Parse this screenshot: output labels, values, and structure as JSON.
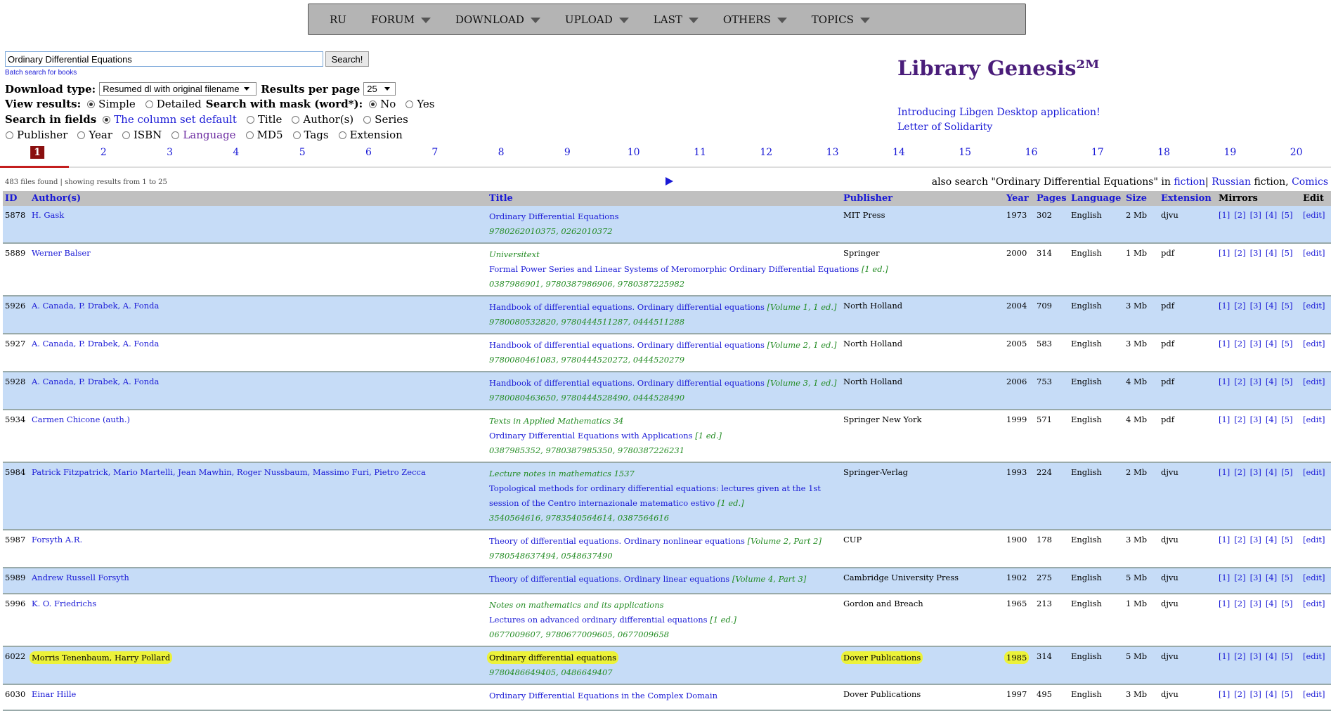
{
  "menu": [
    {
      "label": "RU",
      "caret": false
    },
    {
      "label": "FORUM",
      "caret": true
    },
    {
      "label": "DOWNLOAD",
      "caret": true
    },
    {
      "label": "UPLOAD",
      "caret": true
    },
    {
      "label": "LAST",
      "caret": true
    },
    {
      "label": "OTHERS",
      "caret": true
    },
    {
      "label": "TOPICS",
      "caret": true
    }
  ],
  "search": {
    "value": "Ordinary Differential Equations",
    "button": "Search!",
    "batch_link": "Batch search for books"
  },
  "options": {
    "download_type_label": "Download type:",
    "download_type_value": "Resumed dl with original filename",
    "results_per_page_label": "Results per page",
    "results_per_page_value": "25",
    "view_results_label": "View results:",
    "view_simple": "Simple",
    "view_detailed": "Detailed",
    "mask_label": "Search with mask (word*):",
    "mask_no": "No",
    "mask_yes": "Yes",
    "fields_label": "Search in fields",
    "fields": [
      "The column set default",
      "Title",
      "Author(s)",
      "Series",
      "Publisher",
      "Year",
      "ISBN",
      "Language",
      "MD5",
      "Tags",
      "Extension"
    ]
  },
  "site": {
    "title": "Library Genesis²ᴹ",
    "desktop_link": "Introducing Libgen Desktop application!",
    "solidarity_link": "Letter of Solidarity"
  },
  "pagination": {
    "current": "1",
    "pages": [
      "1",
      "2",
      "3",
      "4",
      "5",
      "6",
      "7",
      "8",
      "9",
      "10",
      "11",
      "12",
      "13",
      "14",
      "15",
      "16",
      "17",
      "18",
      "19",
      "20"
    ]
  },
  "results_info": "483 files found | showing results from 1 to 25",
  "also_search": {
    "prefix": "also search \"Ordinary Differential Equations\" in ",
    "fiction": "fiction",
    "sep1": "| ",
    "russian": "Russian",
    "mid": " fiction, ",
    "comics": "Comics"
  },
  "columns": [
    "ID",
    "Author(s)",
    "Title",
    "Publisher",
    "Year",
    "Pages",
    "Language",
    "Size",
    "Extension",
    "Mirrors",
    "Edit"
  ],
  "mirror_labels": [
    "[1]",
    "[2]",
    "[3]",
    "[4]",
    "[5]"
  ],
  "edit_label": "[edit]",
  "rows": [
    {
      "id": "5878",
      "authors": "H. Gask",
      "series": "",
      "title": "Ordinary Differential Equations",
      "edition": "",
      "isbn": "9780262010375, 0262010372",
      "publisher": "MIT Press",
      "year": "1973",
      "pages": "302",
      "language": "English",
      "size": "2 Mb",
      "ext": "djvu",
      "highlight": false
    },
    {
      "id": "5889",
      "authors": "Werner Balser",
      "series": "Universitext",
      "title": "Formal Power Series and Linear Systems of Meromorphic Ordinary Differential Equations",
      "edition": "[1 ed.]",
      "isbn": "0387986901, 9780387986906, 9780387225982",
      "publisher": "Springer",
      "year": "2000",
      "pages": "314",
      "language": "English",
      "size": "1 Mb",
      "ext": "pdf",
      "highlight": false
    },
    {
      "id": "5926",
      "authors": "A. Canada, P. Drabek, A. Fonda",
      "series": "",
      "title": "Handbook of differential equations. Ordinary differential equations",
      "edition": "[Volume 1, 1 ed.]",
      "isbn": "9780080532820, 9780444511287, 0444511288",
      "publisher": "North Holland",
      "year": "2004",
      "pages": "709",
      "language": "English",
      "size": "3 Mb",
      "ext": "pdf",
      "highlight": false
    },
    {
      "id": "5927",
      "authors": "A. Canada, P. Drabek, A. Fonda",
      "series": "",
      "title": "Handbook of differential equations. Ordinary differential equations",
      "edition": "[Volume 2, 1 ed.]",
      "isbn": "9780080461083, 9780444520272, 0444520279",
      "publisher": "North Holland",
      "year": "2005",
      "pages": "583",
      "language": "English",
      "size": "3 Mb",
      "ext": "pdf",
      "highlight": false
    },
    {
      "id": "5928",
      "authors": "A. Canada, P. Drabek, A. Fonda",
      "series": "",
      "title": "Handbook of differential equations. Ordinary differential equations",
      "edition": "[Volume 3, 1 ed.]",
      "isbn": "9780080463650, 9780444528490, 0444528490",
      "publisher": "North Holland",
      "year": "2006",
      "pages": "753",
      "language": "English",
      "size": "4 Mb",
      "ext": "pdf",
      "highlight": false
    },
    {
      "id": "5934",
      "authors": "Carmen Chicone (auth.)",
      "series": "Texts in Applied Mathematics 34",
      "title": "Ordinary Differential Equations with Applications",
      "edition": "[1 ed.]",
      "isbn": "0387985352, 9780387985350, 9780387226231",
      "publisher": "Springer New York",
      "year": "1999",
      "pages": "571",
      "language": "English",
      "size": "4 Mb",
      "ext": "pdf",
      "highlight": false
    },
    {
      "id": "5984",
      "authors": "Patrick Fitzpatrick, Mario Martelli, Jean Mawhin, Roger Nussbaum, Massimo Furi, Pietro Zecca",
      "series": "Lecture notes in mathematics 1537",
      "title": "Topological methods for ordinary differential equations: lectures given at the 1st session of the Centro internazionale matematico estivo",
      "edition": "[1 ed.]",
      "isbn": "3540564616, 9783540564614, 0387564616",
      "publisher": "Springer-Verlag",
      "year": "1993",
      "pages": "224",
      "language": "English",
      "size": "2 Mb",
      "ext": "djvu",
      "highlight": false
    },
    {
      "id": "5987",
      "authors": "Forsyth A.R.",
      "series": "",
      "title": "Theory of differential equations. Ordinary nonlinear equations",
      "edition": "[Volume 2, Part 2]",
      "isbn": "9780548637494, 0548637490",
      "publisher": "CUP",
      "year": "1900",
      "pages": "178",
      "language": "English",
      "size": "3 Mb",
      "ext": "djvu",
      "highlight": false
    },
    {
      "id": "5989",
      "authors": "Andrew Russell Forsyth",
      "series": "",
      "title": "Theory of differential equations. Ordinary linear equations",
      "edition": "[Volume 4, Part 3]",
      "isbn": "",
      "publisher": "Cambridge University Press",
      "year": "1902",
      "pages": "275",
      "language": "English",
      "size": "5 Mb",
      "ext": "djvu",
      "highlight": false
    },
    {
      "id": "5996",
      "authors": "K. O. Friedrichs",
      "series": "Notes on mathematics and its applications",
      "title": "Lectures on advanced ordinary differential equations",
      "edition": "[1 ed.]",
      "isbn": "0677009607, 9780677009605, 0677009658",
      "publisher": "Gordon and Breach",
      "year": "1965",
      "pages": "213",
      "language": "English",
      "size": "1 Mb",
      "ext": "djvu",
      "highlight": false
    },
    {
      "id": "6022",
      "authors": "Morris Tenenbaum, Harry Pollard",
      "series": "",
      "title": "Ordinary differential equations",
      "edition": "",
      "isbn": "9780486649405, 0486649407",
      "publisher": "Dover Publications",
      "year": "1985",
      "pages": "314",
      "language": "English",
      "size": "5 Mb",
      "ext": "djvu",
      "highlight": true
    },
    {
      "id": "6030",
      "authors": "Einar Hille",
      "series": "",
      "title": "Ordinary Differential Equations in the Complex Domain",
      "edition": "",
      "isbn": "",
      "publisher": "Dover Publications",
      "year": "1997",
      "pages": "495",
      "language": "English",
      "size": "3 Mb",
      "ext": "djvu",
      "highlight": false
    }
  ]
}
